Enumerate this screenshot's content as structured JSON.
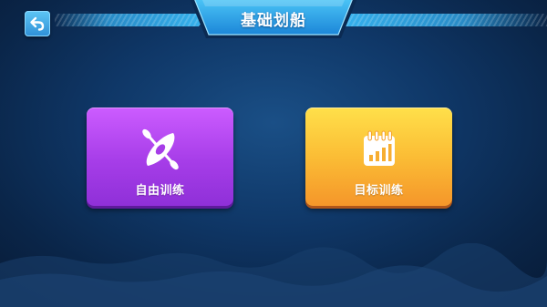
{
  "header": {
    "title": "基础划船",
    "back_icon": "back-arrow-icon"
  },
  "modes": [
    {
      "label": "自由训练",
      "icon": "kayak-paddle-icon",
      "color": "#a63de8"
    },
    {
      "label": "目标训练",
      "icon": "calendar-chart-icon",
      "color": "#fbbd35"
    }
  ],
  "theme": {
    "background": "#0f3767",
    "accent": "#35b2ee"
  }
}
